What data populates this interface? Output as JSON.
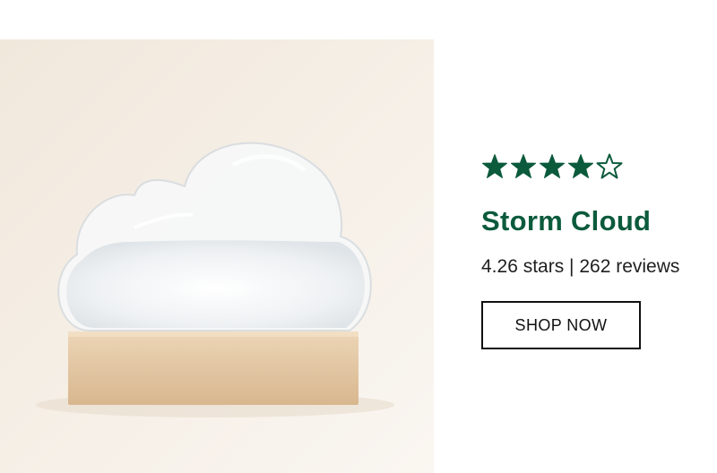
{
  "product": {
    "name": "Storm Cloud",
    "rating": 4.26,
    "rating_max": 5,
    "reviews_text": "4.26 stars | 262 reviews",
    "cta_label": "SHOP NOW",
    "image": {
      "subject": "storm-cloud-glass-on-wooden-base"
    }
  },
  "colors": {
    "brand_green": "#0b5a3c",
    "text": "#1f1f1f",
    "button_border": "#111111",
    "photo_background": "#f4ede3",
    "wood": "#e4c9a6"
  },
  "icons": {
    "filled_star": "star-filled-icon",
    "empty_star": "star-outline-icon"
  }
}
